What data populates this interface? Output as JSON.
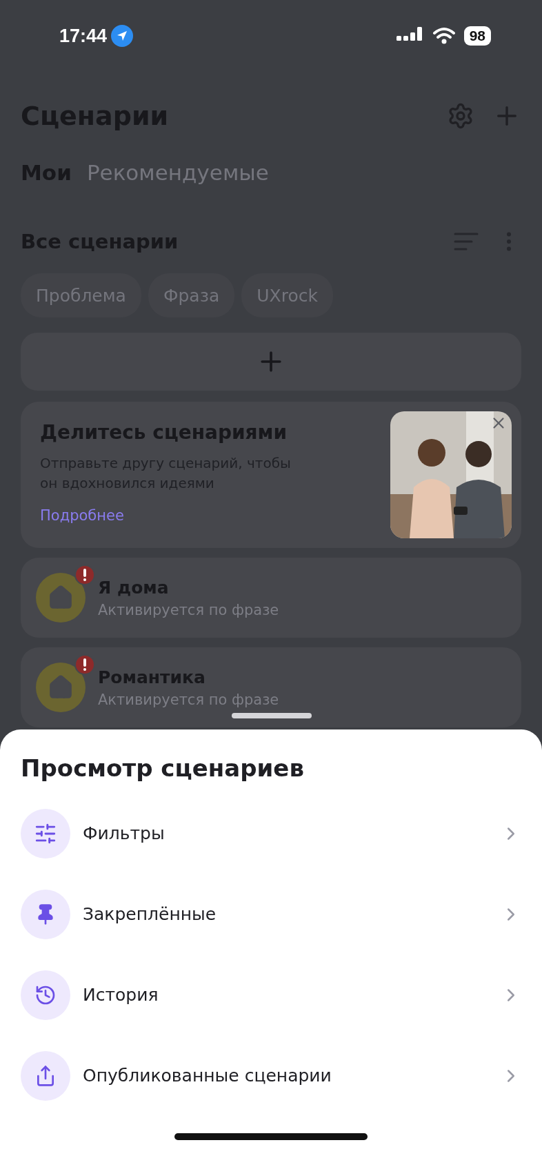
{
  "status_bar": {
    "time": "17:44",
    "battery": "98"
  },
  "header": {
    "title": "Сценарии"
  },
  "tabs": [
    {
      "label": "Мои",
      "selected": true
    },
    {
      "label": "Рекомендуемые",
      "selected": false
    }
  ],
  "section": {
    "title": "Все сценарии"
  },
  "chips": [
    "Проблема",
    "Фраза",
    "UXrock"
  ],
  "promo": {
    "title": "Делитесь сценариями",
    "text": "Отправьте другу сценарий, чтобы он вдохновился идеями",
    "link": "Подробнее"
  },
  "scenarios": [
    {
      "name": "Я дома",
      "subtitle": "Активируется по фразе",
      "warning": true
    },
    {
      "name": "Романтика",
      "subtitle": "Активируется по фразе",
      "warning": true
    }
  ],
  "sheet": {
    "title": "Просмотр сценариев",
    "items": [
      {
        "kind": "filters",
        "label": "Фильтры"
      },
      {
        "kind": "pinned",
        "label": "Закреплённые"
      },
      {
        "kind": "history",
        "label": "История"
      },
      {
        "kind": "published",
        "label": "Опубликованные сценарии"
      }
    ]
  }
}
